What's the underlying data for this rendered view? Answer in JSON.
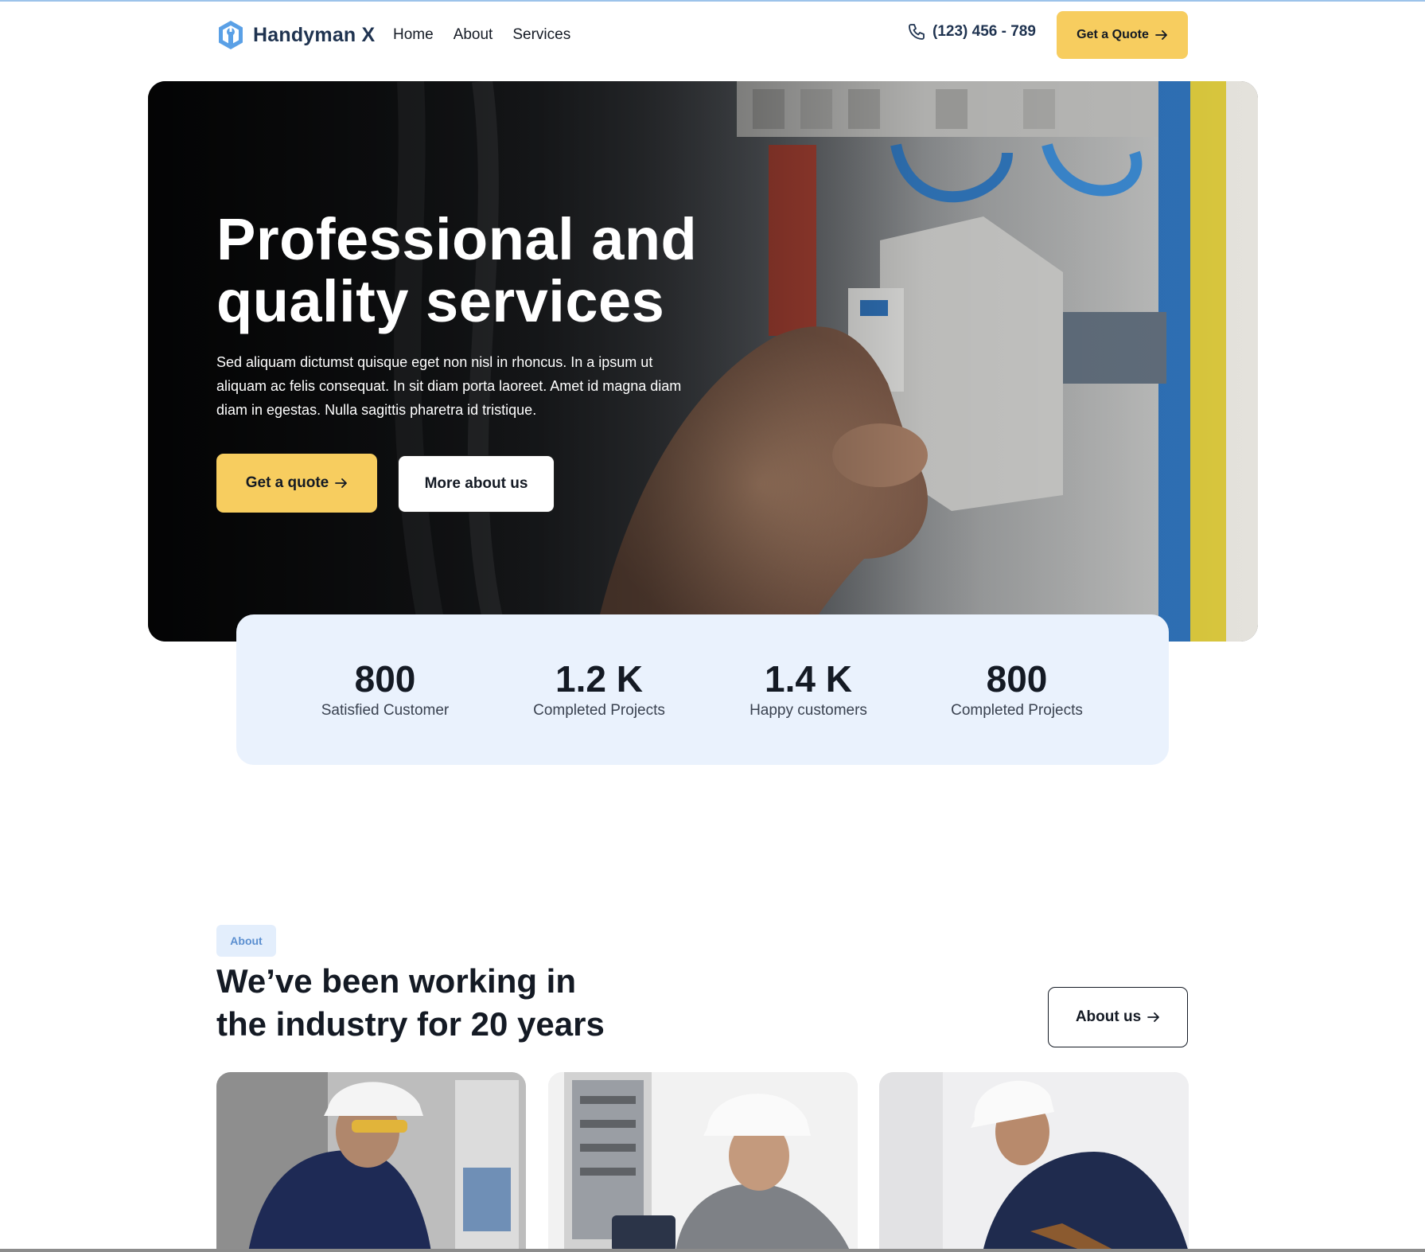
{
  "header": {
    "brand": "Handyman X",
    "nav": [
      "Home",
      "About",
      "Services"
    ],
    "phone": "(123) 456 - 789",
    "quote_label": "Get a Quote"
  },
  "hero": {
    "title_line1": "Professional and",
    "title_line2": "quality services",
    "description": "Sed aliquam dictumst quisque eget non nisl in rhoncus. In a ipsum ut aliquam ac felis consequat. In sit diam porta laoreet. Amet id magna diam diam in egestas. Nulla sagittis pharetra id tristique.",
    "quote_button": "Get a quote",
    "more_button": "More about us"
  },
  "stats": [
    {
      "value": "800",
      "label": "Satisfied Customer"
    },
    {
      "value": "1.2 K",
      "label": "Completed Projects"
    },
    {
      "value": "1.4 K",
      "label": "Happy customers"
    },
    {
      "value": "800",
      "label": "Completed Projects"
    }
  ],
  "about": {
    "tag": "About",
    "title_line1": "We’ve been working in",
    "title_line2": "the industry for 20 years",
    "button": "About us"
  },
  "colors": {
    "accent": "#f7cd5f",
    "brand": "#1f3350",
    "logo_blue": "#5aa0e6",
    "stats_bg": "#eaf2fd"
  },
  "icons": {
    "logo": "hexagon-wrench-icon",
    "phone": "phone-icon",
    "arrow": "arrow-right-icon"
  }
}
